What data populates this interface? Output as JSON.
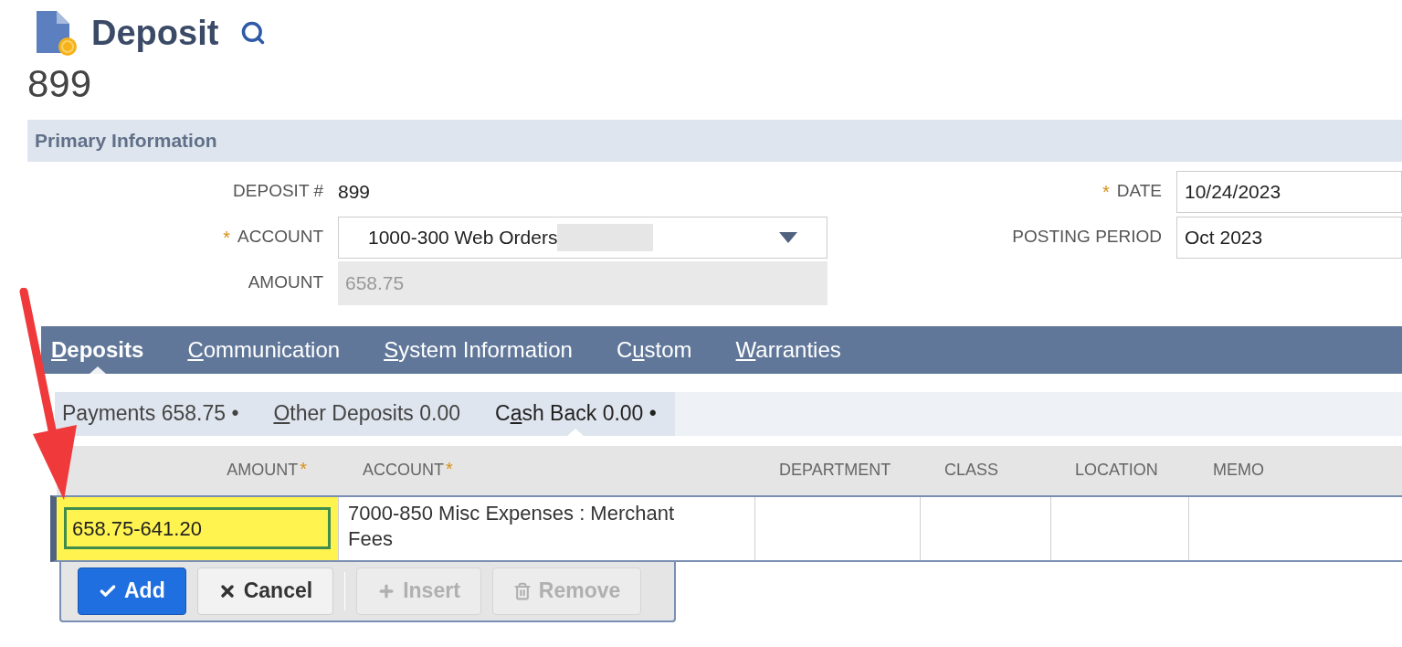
{
  "header": {
    "title": "Deposit",
    "record_number": "899"
  },
  "section": {
    "title": "Primary Information"
  },
  "left_fields": [
    {
      "label": "DEPOSIT #",
      "kind": "text",
      "value": "899"
    },
    {
      "label": "ACCOUNT",
      "marker": "*",
      "kind": "select",
      "value": "1000-300 Web Orders",
      "redacted": true
    },
    {
      "label": "AMOUNT",
      "kind": "readonly",
      "value": "658.75"
    }
  ],
  "right_fields": [
    {
      "label": "DATE",
      "marker": "*",
      "kind": "input",
      "value": "10/24/2023"
    },
    {
      "label": "POSTING PERIOD",
      "kind": "input",
      "value": "Oct 2023"
    }
  ],
  "tabs": [
    {
      "key": "D",
      "after": "eposits",
      "selected": true
    },
    {
      "key": "C",
      "after": "ommunication",
      "selected": false
    },
    {
      "key": "S",
      "after": "ystem Information",
      "selected": false
    },
    {
      "before": "C",
      "key": "u",
      "after": "stom",
      "selected": false
    },
    {
      "key": "W",
      "after": "arranties",
      "selected": false
    }
  ],
  "subtabs": [
    {
      "after": "Payments 658.75 •",
      "selected": false
    },
    {
      "key": "O",
      "after": "ther Deposits 0.00",
      "selected": false
    },
    {
      "before": "C",
      "key": "a",
      "after": "sh Back 0.00 •",
      "selected": true
    }
  ],
  "table": {
    "columns": [
      {
        "label": "AMOUNT",
        "marker": "*"
      },
      {
        "label": "ACCOUNT",
        "marker": "*"
      },
      {
        "label": "DEPARTMENT"
      },
      {
        "label": "CLASS"
      },
      {
        "label": "LOCATION"
      },
      {
        "label": "MEMO"
      }
    ],
    "rows": [
      {
        "cells": [
          "658.75-641.20",
          "7000-850 Misc Expenses : Merchant Fees",
          "",
          "",
          "",
          ""
        ],
        "highlighted": true
      }
    ]
  },
  "buttons": [
    {
      "label": "Add",
      "kind": "primary",
      "disabled": false
    },
    {
      "label": "Cancel",
      "kind": "cancel",
      "disabled": false
    },
    {
      "label": "Insert",
      "kind": "insert",
      "disabled": true
    },
    {
      "label": "Remove",
      "kind": "remove",
      "disabled": true
    }
  ],
  "annotation": {
    "kind": "arrow"
  }
}
